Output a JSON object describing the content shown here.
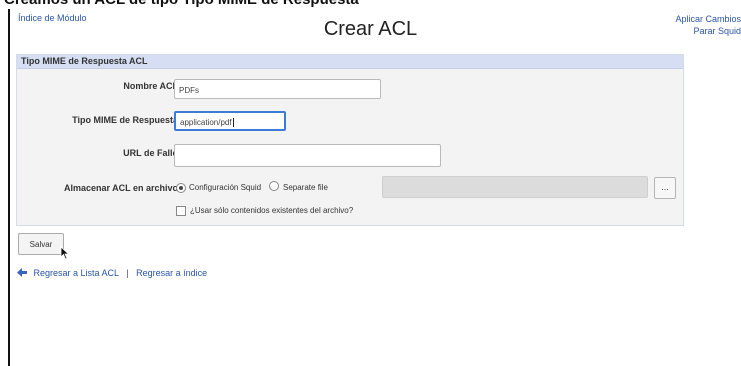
{
  "caption": "Creamos un ACL de tipo Tipo MIME de Respuesta",
  "title": "Crear ACL",
  "top_left_link": "Índice de Módulo",
  "top_right_links": [
    "Aplicar Cambios",
    "Parar Squid"
  ],
  "panel": {
    "header": "Tipo MIME de Respuesta ACL",
    "fields": {
      "acl_name": {
        "label": "Nombre ACL",
        "value": "PDFs"
      },
      "mime_type": {
        "label": "Tipo MIME de Respuesta",
        "value": "application/pdf"
      },
      "fail_url": {
        "label": "URL de Fallo",
        "value": ""
      }
    },
    "store": {
      "label": "Almacenar ACL en archivo",
      "option_squid": "Configuración Squid",
      "option_file": "Separate file",
      "selected": "Configuración Squid",
      "browse_label": "...",
      "checkbox_label": "¿Usar sólo contenidos existentes del archivo?",
      "checkbox_checked": false
    }
  },
  "save_button": "Salvar",
  "back_links": {
    "acl_list": "Regresar a Lista ACL",
    "separator": "|",
    "index": "Regresar a índice"
  },
  "colors": {
    "link": "#2a54a8",
    "panel_header_bg": "#d5def2",
    "panel_bg": "#f3f3f3",
    "focus_border": "#3d7bd9"
  }
}
